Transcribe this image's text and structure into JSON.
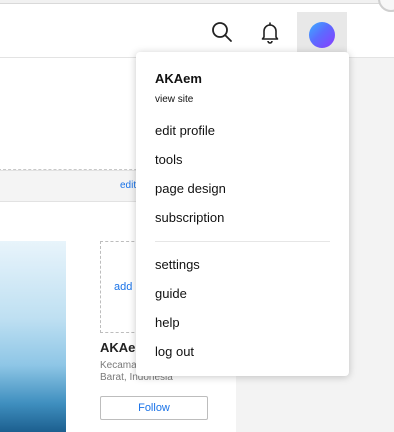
{
  "header": {
    "icons": {
      "search": "search-icon",
      "bell": "bell-icon",
      "avatar": "avatar"
    },
    "avatar_colors": [
      "#3bb0ff",
      "#5b6cff",
      "#8b3cff"
    ]
  },
  "background": {
    "edit_link": "edit",
    "add_link": "add",
    "card_name": "AKAem",
    "card_location_line1": "Kecamatan",
    "card_location_line2": "Barat, Indonesia",
    "follow_label": "Follow"
  },
  "menu": {
    "username": "AKAem",
    "view_site": "view site",
    "items": [
      {
        "label": "edit profile"
      },
      {
        "label": "tools"
      },
      {
        "label": "page design"
      },
      {
        "label": "subscription"
      }
    ],
    "items_secondary": [
      {
        "label": "settings"
      },
      {
        "label": "guide"
      },
      {
        "label": "help"
      },
      {
        "label": "log out"
      }
    ]
  },
  "colors": {
    "accent": "#1a73e8"
  }
}
